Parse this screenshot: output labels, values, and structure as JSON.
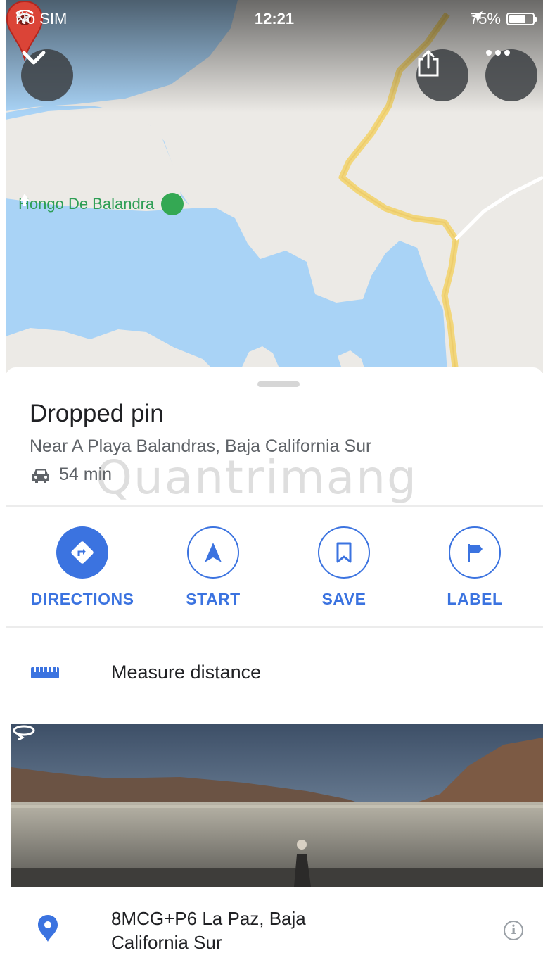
{
  "status_bar": {
    "carrier": "No SIM",
    "time": "12:21",
    "battery_percent": "75%",
    "battery_level": 0.75,
    "icons": [
      "wifi-icon",
      "activity-spinner-icon",
      "location-arrow-icon",
      "battery-icon"
    ]
  },
  "map": {
    "place_label": "Hongo De Balandra",
    "place_icon": "park-tree-icon",
    "buttons": [
      "collapse-chevron-icon",
      "share-icon",
      "more-options-icon"
    ],
    "colors": {
      "water": "#a9d3f6",
      "land": "#eceae6",
      "road": "#f2d67a",
      "pin": "#db4437",
      "park": "#34a853"
    }
  },
  "place": {
    "title": "Dropped pin",
    "subtitle": "Near A Playa Balandras, Baja California Sur",
    "drive_time": "54 min",
    "drive_icon": "car-icon"
  },
  "actions": [
    {
      "label": "DIRECTIONS",
      "icon": "directions-icon",
      "style": "filled"
    },
    {
      "label": "START",
      "icon": "navigation-arrow-icon",
      "style": "outline"
    },
    {
      "label": "SAVE",
      "icon": "bookmark-icon",
      "style": "outline"
    },
    {
      "label": "LABEL",
      "icon": "flag-icon",
      "style": "outline"
    }
  ],
  "accent_color": "#3b73e0",
  "measure": {
    "label": "Measure distance",
    "icon": "ruler-icon"
  },
  "photo": {
    "icon": "panorama-360-icon"
  },
  "plus_code": {
    "text": "8MCG+P6 La Paz, Baja California Sur",
    "icon": "location-pin-icon",
    "info_icon": "info-icon"
  },
  "watermark": "Quantrimang"
}
